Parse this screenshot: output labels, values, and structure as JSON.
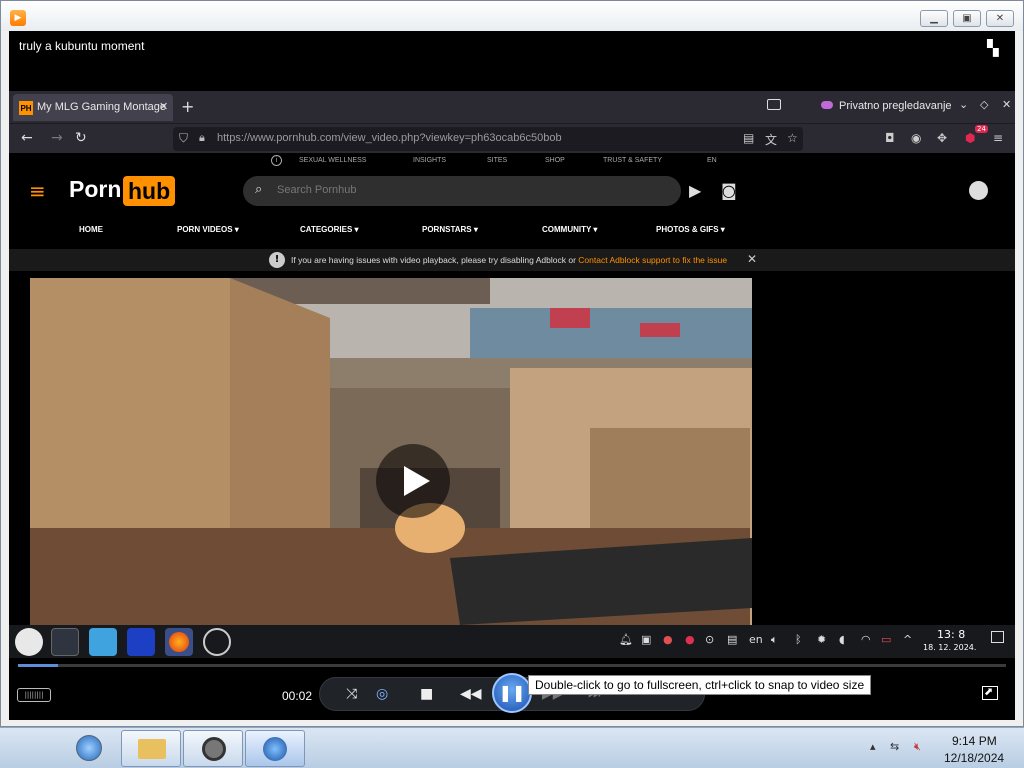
{
  "player": {
    "title": "truly a kubuntu moment",
    "time": "00:02",
    "tooltip": "Double-click to go to fullscreen, ctrl+click to snap to video size",
    "progress_fraction": 0.04
  },
  "browser": {
    "tab_title": "My MLG Gaming Montage",
    "private_label": "Privatno pregledavanje",
    "url": "https://www.pornhub.com/view_video.php?viewkey=ph63ocab6c50bob",
    "notification_count": "24"
  },
  "site": {
    "top_links": [
      "SEXUAL WELLNESS",
      "INSIGHTS",
      "SITES",
      "SHOP",
      "TRUST & SAFETY",
      "EN"
    ],
    "logo_part1": "Porn",
    "logo_part2": "hub",
    "search_placeholder": "Search Pornhub",
    "nav": [
      "HOME",
      "PORN VIDEOS ▾",
      "CATEGORIES ▾",
      "PORNSTARS ▾",
      "COMMUNITY ▾",
      "PHOTOS & GIFS ▾"
    ],
    "alert_text": "If you are having issues with video playback, please try disabling Adblock or ",
    "alert_link": "Contact Adblock support to fix the issue"
  },
  "recorded_taskbar": {
    "time": "13: 8",
    "date": "18. 12. 2024.",
    "lang": "en"
  },
  "host_taskbar": {
    "time": "9:14 PM",
    "date": "12/18/2024"
  },
  "colors": {
    "brand_orange": "#ff9000",
    "seek_blue": "#5b8fd8"
  }
}
